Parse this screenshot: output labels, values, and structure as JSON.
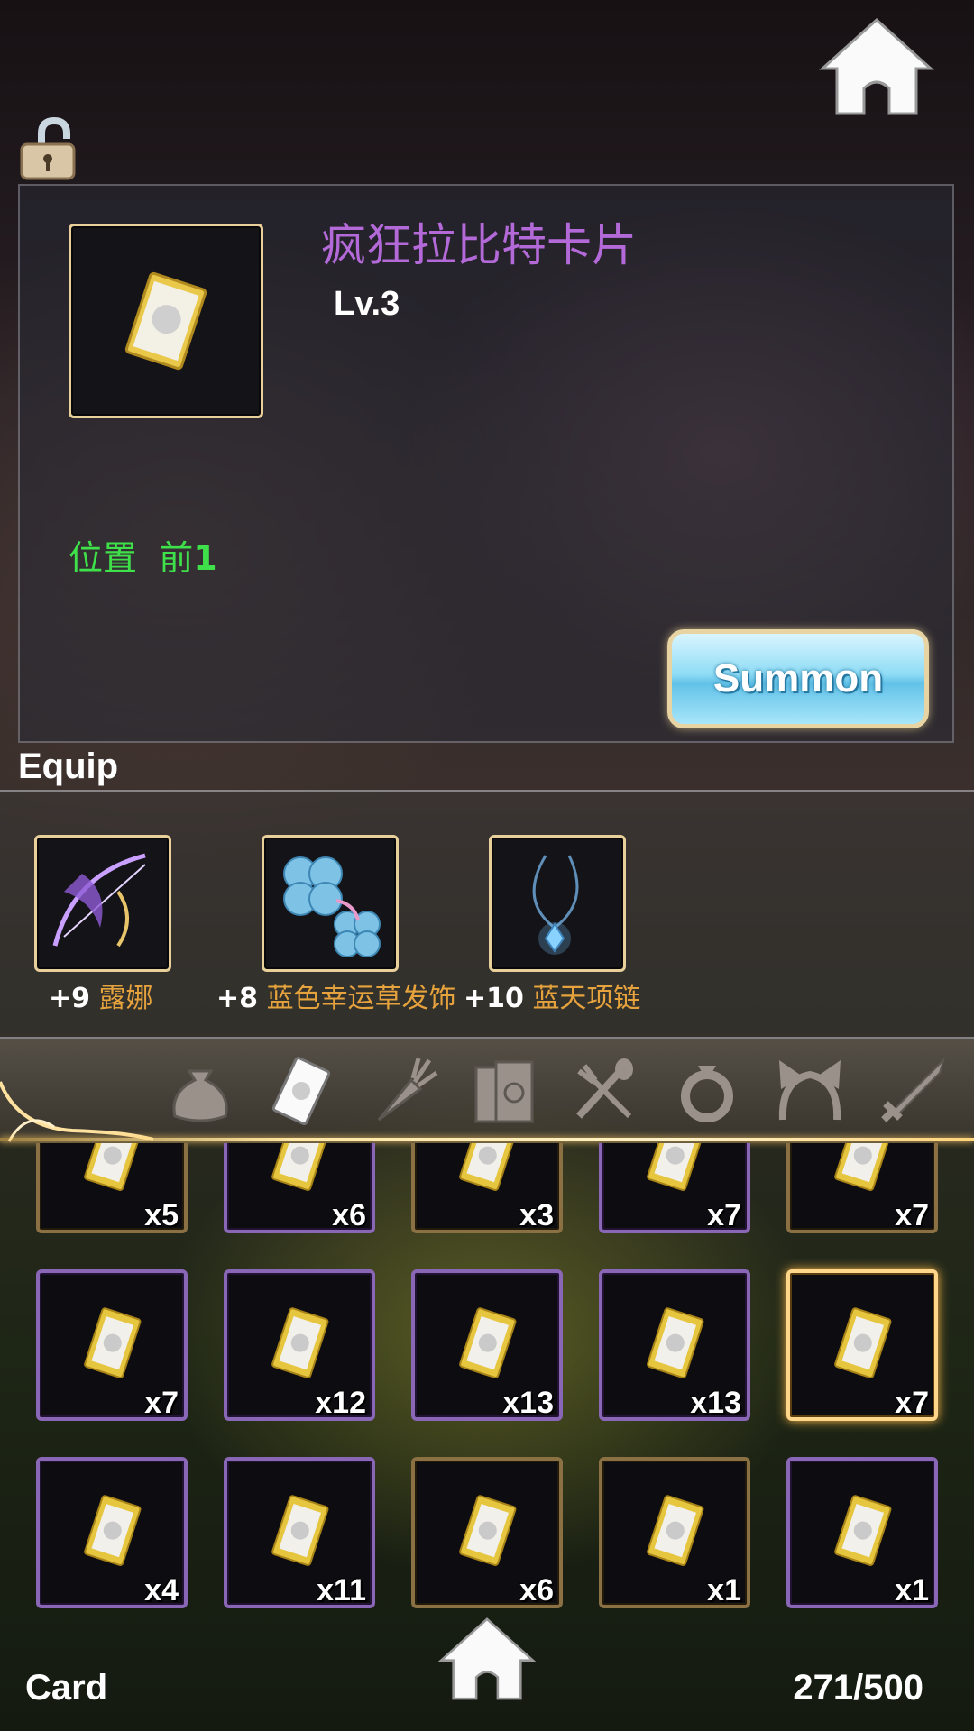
{
  "header": {
    "home_icon": "home-icon",
    "lock_icon": "unlocked-padlock-icon"
  },
  "detail": {
    "icon": "rabbit-card-icon",
    "name": "疯狂拉比特卡片",
    "level": "Lv.3",
    "position_label": "位置",
    "position_value": "前",
    "position_number": "1",
    "summon_label": "Summon"
  },
  "equip": {
    "title": "Equip",
    "items": [
      {
        "plus": "+9",
        "name": "露娜",
        "icon": "winged-bow-icon"
      },
      {
        "plus": "+8",
        "name": "蓝色幸运草发饰",
        "icon": "blue-clover-hairpin-icon"
      },
      {
        "plus": "+10",
        "name": "蓝天项链",
        "icon": "blue-crystal-necklace-icon"
      }
    ]
  },
  "tabs": [
    {
      "name": "bag-icon",
      "active": false
    },
    {
      "name": "card-icon",
      "active": true
    },
    {
      "name": "carrot-icon",
      "active": false
    },
    {
      "name": "books-icon",
      "active": false
    },
    {
      "name": "spoon-fork-icon",
      "active": false
    },
    {
      "name": "ring-icon",
      "active": false
    },
    {
      "name": "cat-ear-headband-icon",
      "active": false
    },
    {
      "name": "sword-icon",
      "active": false
    }
  ],
  "inventory": {
    "rows": [
      [
        {
          "count": "x5",
          "frame": "gold"
        },
        {
          "count": "x6",
          "frame": "purple"
        },
        {
          "count": "x3",
          "frame": "gold"
        },
        {
          "count": "x7",
          "frame": "purple"
        },
        {
          "count": "x7",
          "frame": "gold"
        }
      ],
      [
        {
          "count": "x7",
          "frame": "purple"
        },
        {
          "count": "x12",
          "frame": "purple"
        },
        {
          "count": "x13",
          "frame": "purple"
        },
        {
          "count": "x13",
          "frame": "purple"
        },
        {
          "count": "x7",
          "frame": "selected"
        }
      ],
      [
        {
          "count": "x4",
          "frame": "purple"
        },
        {
          "count": "x11",
          "frame": "purple"
        },
        {
          "count": "x6",
          "frame": "gold"
        },
        {
          "count": "x1",
          "frame": "gold"
        },
        {
          "count": "x1",
          "frame": "purple"
        }
      ]
    ]
  },
  "footer": {
    "category": "Card",
    "capacity": "271/500"
  },
  "colors": {
    "name": "#b36ad8",
    "position": "#3fe14a",
    "equip_name": "#e6a23c",
    "gold": "#ffd68a",
    "purple": "#8a67b6"
  }
}
